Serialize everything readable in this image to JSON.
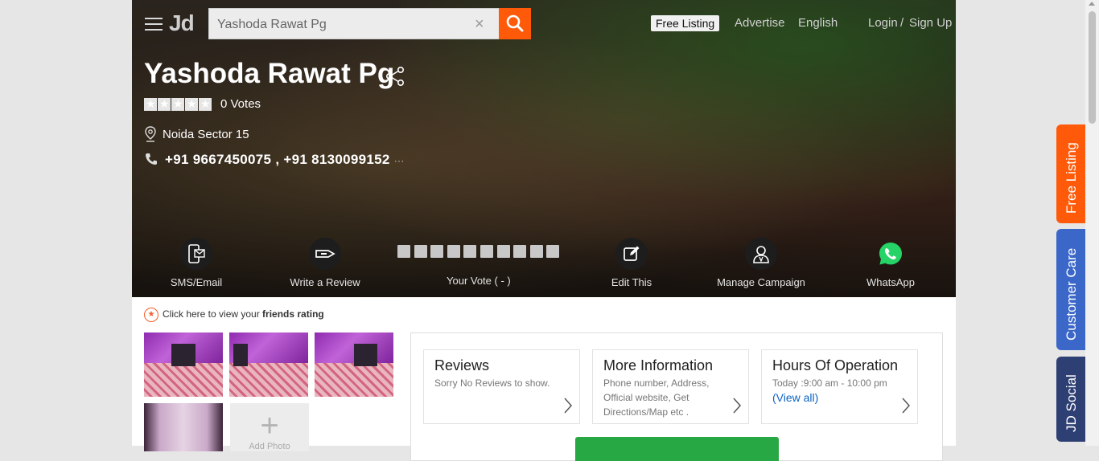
{
  "header": {
    "search_value": "Yashoda Rawat Pg",
    "logo": "Jd",
    "clear_symbol": "×",
    "nav": {
      "free_listing": "Free Listing",
      "advertise": "Advertise",
      "language": "English",
      "login": "Login",
      "separator": "/",
      "signup": "Sign Up"
    }
  },
  "business": {
    "name": "Yashoda Rawat Pg",
    "votes": "0 Votes",
    "rating_stars": 5,
    "location": "Noida Sector 15",
    "phones": "+91 9667450075 , +91 8130099152",
    "more": "···"
  },
  "actions": {
    "sms_email": "SMS/Email",
    "write_review": "Write a Review",
    "your_vote": "Your Vote ( - )",
    "vote_boxes": 10,
    "edit_this": "Edit This",
    "manage_campaign": "Manage Campaign",
    "whatsapp": "WhatsApp"
  },
  "friends": {
    "prefix": "Click here to view your ",
    "bold": "friends rating",
    "icon": "★"
  },
  "photos": {
    "add_label": "Add Photo"
  },
  "cards": {
    "reviews": {
      "title": "Reviews",
      "sub": "Sorry No Reviews to show."
    },
    "more_info": {
      "title": "More Information",
      "sub": "Phone number, Address, Official website, Get Directions/Map etc ."
    },
    "hours": {
      "title": "Hours Of Operation",
      "sub": "Today :9:00 am - 10:00 pm",
      "link": "(View all)"
    }
  },
  "rail": {
    "free_listing": "Free Listing",
    "customer_care": "Customer Care",
    "jd_social": "JD Social"
  },
  "colors": {
    "accent_orange": "#ff5a0a",
    "rail_blue": "#3b67c9",
    "rail_navy": "#2d3f73",
    "whatsapp_green": "#25d366",
    "link_blue": "#0a63c4"
  }
}
